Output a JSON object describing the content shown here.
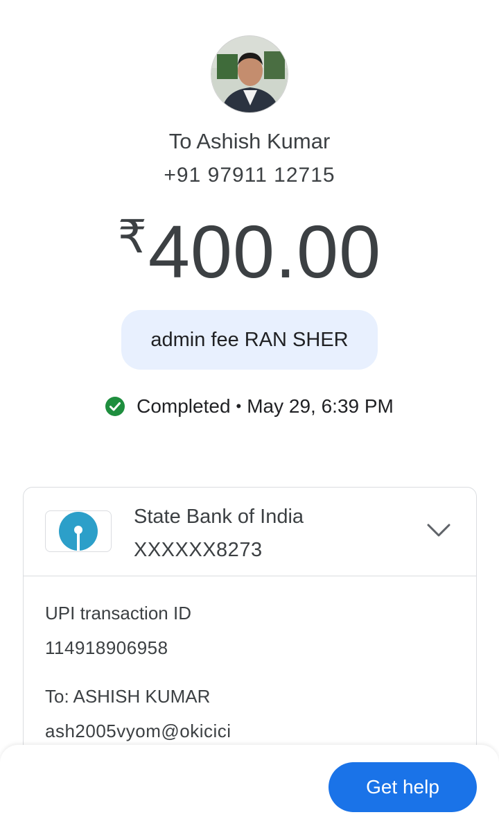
{
  "recipient": {
    "name_line": "To Ashish Kumar",
    "phone": "+91 97911 12715"
  },
  "payment": {
    "currency_symbol": "₹",
    "amount": "400.00",
    "note": "admin fee RAN SHER"
  },
  "status": {
    "text": "Completed",
    "separator": "•",
    "datetime": "May 29, 6:39 PM",
    "color": "#1e8e3e"
  },
  "bank": {
    "name": "State Bank of India",
    "account": "XXXXXX8273",
    "logo_color": "#2c9fc9"
  },
  "details": {
    "upi_label": "UPI transaction ID",
    "upi_id": "114918906958",
    "to_label": "To: ASHISH KUMAR",
    "to_upi": "ash2005vyom@okicici"
  },
  "footer": {
    "help_label": "Get help",
    "accent": "#1a73e8"
  },
  "icons": {
    "status": "check-circle-icon",
    "expand": "chevron-down-icon",
    "bank": "sbi-logo-icon"
  }
}
